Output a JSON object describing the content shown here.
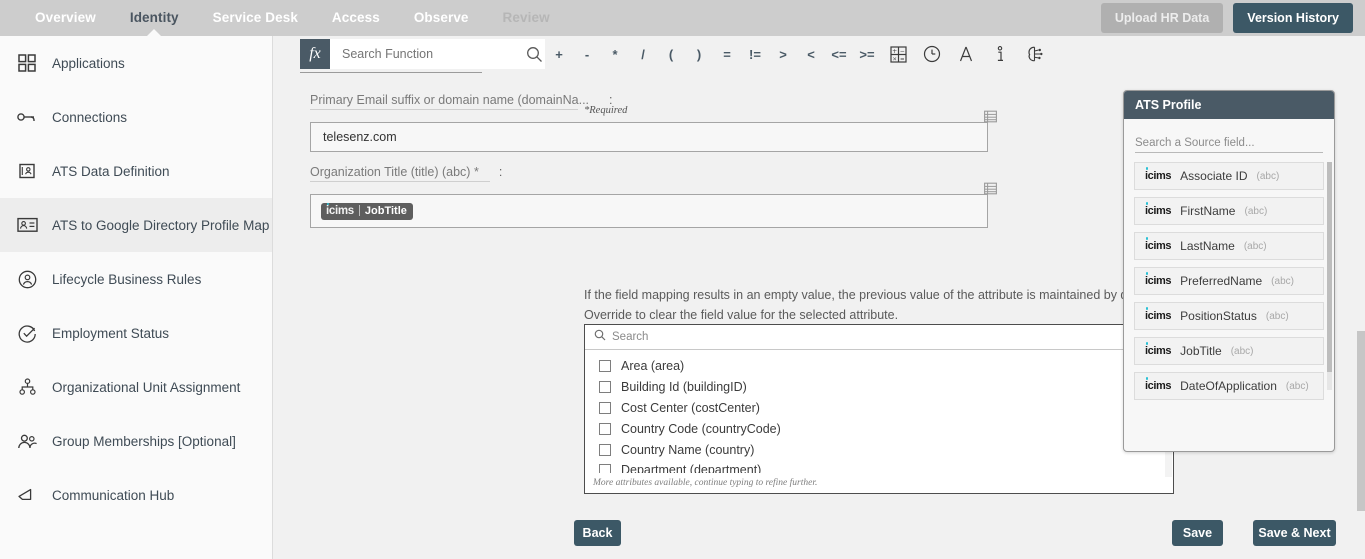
{
  "topnav": {
    "tabs": [
      {
        "label": "Overview",
        "state": "normal"
      },
      {
        "label": "Identity",
        "state": "active"
      },
      {
        "label": "Service Desk",
        "state": "normal"
      },
      {
        "label": "Access",
        "state": "normal"
      },
      {
        "label": "Observe",
        "state": "normal"
      },
      {
        "label": "Review",
        "state": "dim"
      }
    ],
    "upload_label": "Upload HR Data",
    "version_label": "Version History"
  },
  "sidebar": {
    "items": [
      {
        "label": "Applications",
        "icon": "grid-icon",
        "active": false
      },
      {
        "label": "Connections",
        "icon": "key-icon",
        "active": false
      },
      {
        "label": "ATS Data Definition",
        "icon": "contact-card-icon",
        "active": false
      },
      {
        "label": "ATS to Google Directory Profile Map",
        "icon": "id-card-icon",
        "active": true
      },
      {
        "label": "Lifecycle Business Rules",
        "icon": "user-circle-icon",
        "active": false
      },
      {
        "label": "Employment Status",
        "icon": "check-circle-icon",
        "active": false
      },
      {
        "label": "Organizational Unit Assignment",
        "icon": "org-tree-icon",
        "active": false
      },
      {
        "label": "Group Memberships [Optional]",
        "icon": "users-icon",
        "active": false
      },
      {
        "label": "Communication Hub",
        "icon": "megaphone-icon",
        "active": false
      }
    ]
  },
  "formula_bar": {
    "fx_label": "fx",
    "search_placeholder": "Search Function",
    "search_icon": "magnifier-icon",
    "operators": [
      "+",
      "-",
      "*",
      "/",
      "(",
      ")",
      "=",
      "!=",
      ">",
      "<",
      "<=",
      ">="
    ],
    "icons": [
      "calculator-icon",
      "clock-icon",
      "text-format-icon",
      "info-icon",
      "brain-icon"
    ],
    "required_note": "*Required"
  },
  "fields": [
    {
      "label": "Primary Email suffix or domain name (domainNa...",
      "colon": ":",
      "value": "telesenz.com",
      "type": "text",
      "grid_icon": "table-icon"
    },
    {
      "label": "Organization Title (title) (abc) *",
      "colon": ":",
      "chip": {
        "brand": "icims",
        "field": "JobTitle"
      },
      "type": "chip",
      "grid_icon": "table-icon"
    }
  ],
  "help_text": {
    "line1": "If the field mapping results in an empty value, the previous value of the attribute is maintained by default.",
    "line2": "Override to clear the field value for the selected attribute."
  },
  "picker": {
    "search_placeholder": "Search",
    "search_icon": "magnifier-icon",
    "options": [
      {
        "label": "Area (area)",
        "checked": false
      },
      {
        "label": "Building Id (buildingID)",
        "checked": false
      },
      {
        "label": "Cost Center (costCenter)",
        "checked": false
      },
      {
        "label": "Country Code (countryCode)",
        "checked": false
      },
      {
        "label": "Country Name (country)",
        "checked": false
      },
      {
        "label": "Department (department)",
        "checked": false
      }
    ],
    "footer": "More attributes available, continue typing to refine further."
  },
  "add_button": {
    "icon": "plus-circle-icon"
  },
  "ats_panel": {
    "title": "ATS Profile",
    "search_placeholder": "Search a Source field...",
    "fields": [
      {
        "brand": "icims",
        "name": "Associate ID",
        "type": "(abc)"
      },
      {
        "brand": "icims",
        "name": "FirstName",
        "type": "(abc)"
      },
      {
        "brand": "icims",
        "name": "LastName",
        "type": "(abc)"
      },
      {
        "brand": "icims",
        "name": "PreferredName",
        "type": "(abc)"
      },
      {
        "brand": "icims",
        "name": "PositionStatus",
        "type": "(abc)"
      },
      {
        "brand": "icims",
        "name": "JobTitle",
        "type": "(abc)"
      },
      {
        "brand": "icims",
        "name": "DateOfApplication",
        "type": "(abc)"
      }
    ]
  },
  "footer": {
    "back_label": "Back",
    "save_label": "Save",
    "save_next_label": "Save & Next"
  },
  "colors": {
    "accent_dark": "#3c5866",
    "header_bg": "#cdcdcd",
    "panel_header": "#4a5a66",
    "brand_dot": "#29c1d6"
  }
}
